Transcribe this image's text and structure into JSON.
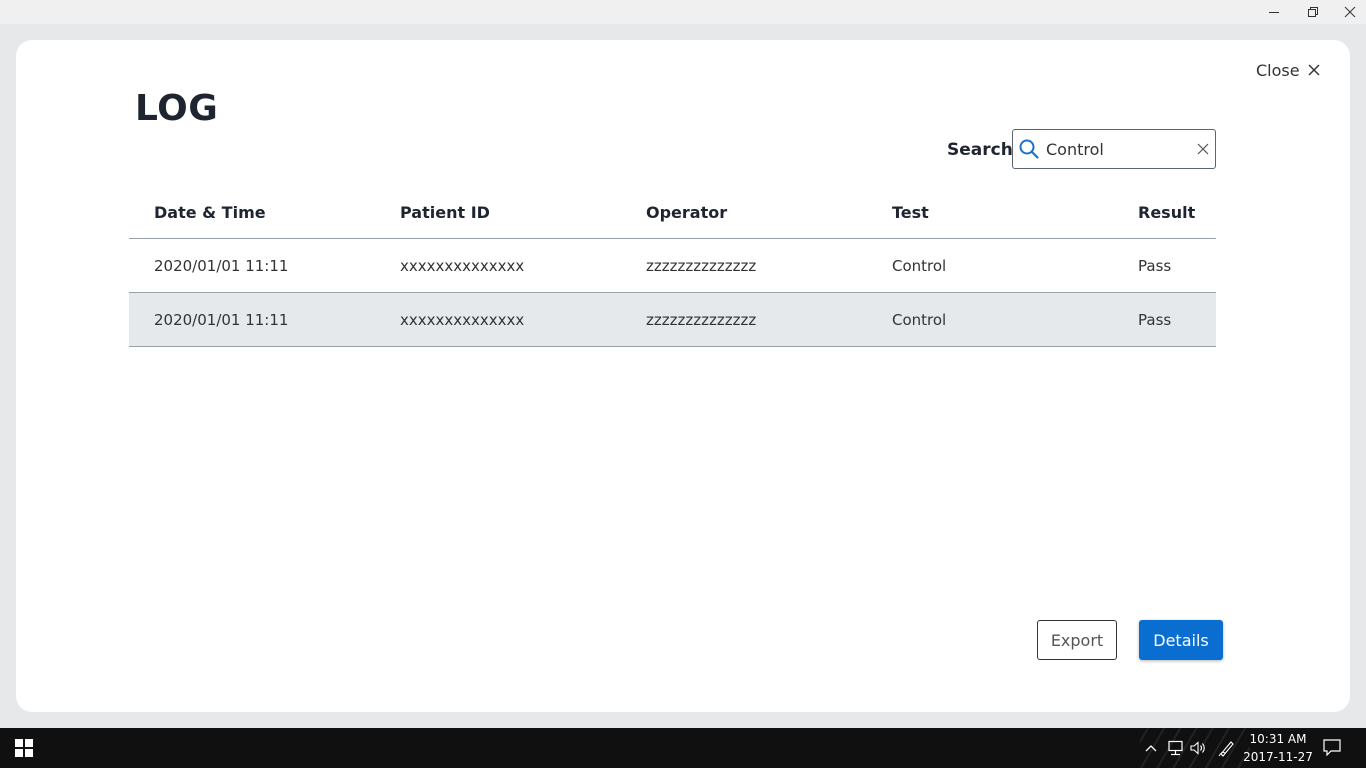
{
  "window": {
    "minimize_glyph": "—",
    "maximize_glyph": "❐",
    "close_glyph": "✕"
  },
  "dialog": {
    "close_label": "Close",
    "title": "LOG"
  },
  "search": {
    "label": "Search",
    "value": "Control"
  },
  "table": {
    "columns": [
      "Date & Time",
      "Patient ID",
      "Operator",
      "Test",
      "Result"
    ],
    "rows": [
      {
        "datetime": "2020/01/01 11:11",
        "patient_id": "xxxxxxxxxxxxxx",
        "operator": "zzzzzzzzzzzzzz",
        "test": "Control",
        "result": "Pass"
      },
      {
        "datetime": "2020/01/01 11:11",
        "patient_id": "xxxxxxxxxxxxxx",
        "operator": "zzzzzzzzzzzzzz",
        "test": "Control",
        "result": "Pass"
      }
    ]
  },
  "actions": {
    "export_label": "Export",
    "details_label": "Details"
  },
  "taskbar": {
    "time": "10:31 AM",
    "date": "2017-11-27"
  },
  "colors": {
    "accent": "#0a6ed1",
    "search_icon": "#1a73c9",
    "selected_row": "#e6e9ec"
  },
  "icons": {
    "close": "close-icon",
    "search": "search-icon",
    "clear": "clear-icon",
    "start": "windows-start-icon",
    "tray_up": "chevron-up-icon",
    "network": "network-icon",
    "volume": "volume-icon",
    "pen": "pen-icon",
    "notifications": "notification-icon"
  }
}
